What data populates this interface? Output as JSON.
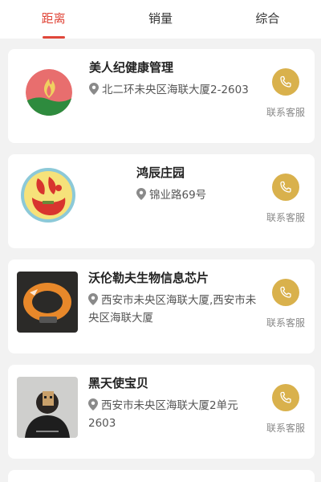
{
  "tabs": [
    {
      "label": "距离",
      "active": true
    },
    {
      "label": "销量",
      "active": false
    },
    {
      "label": "综合",
      "active": false
    }
  ],
  "stores": [
    {
      "name": "美人纪健康管理",
      "address": "北二环未央区海联大厦2-2603",
      "call_label": "联系客服",
      "logo": "flame-logo"
    },
    {
      "name": "鸿辰庄园",
      "address": "锦业路69号",
      "call_label": "联系客服",
      "logo": "duck-logo"
    },
    {
      "name": "沃伦勒夫生物信息芯片",
      "address": "西安市未央区海联大厦,西安市未央区海联大厦",
      "call_label": "联系客服",
      "logo": "band-photo"
    },
    {
      "name": "黑天使宝贝",
      "address": "西安市未央区海联大厦2单元2603",
      "call_label": "联系客服",
      "logo": "portrait-photo"
    }
  ],
  "colors": {
    "accent": "#e0473a",
    "call_button": "#d9b14c",
    "background": "#f2f2f2"
  },
  "icons": {
    "location": "location-pin-icon",
    "call": "phone-icon"
  }
}
